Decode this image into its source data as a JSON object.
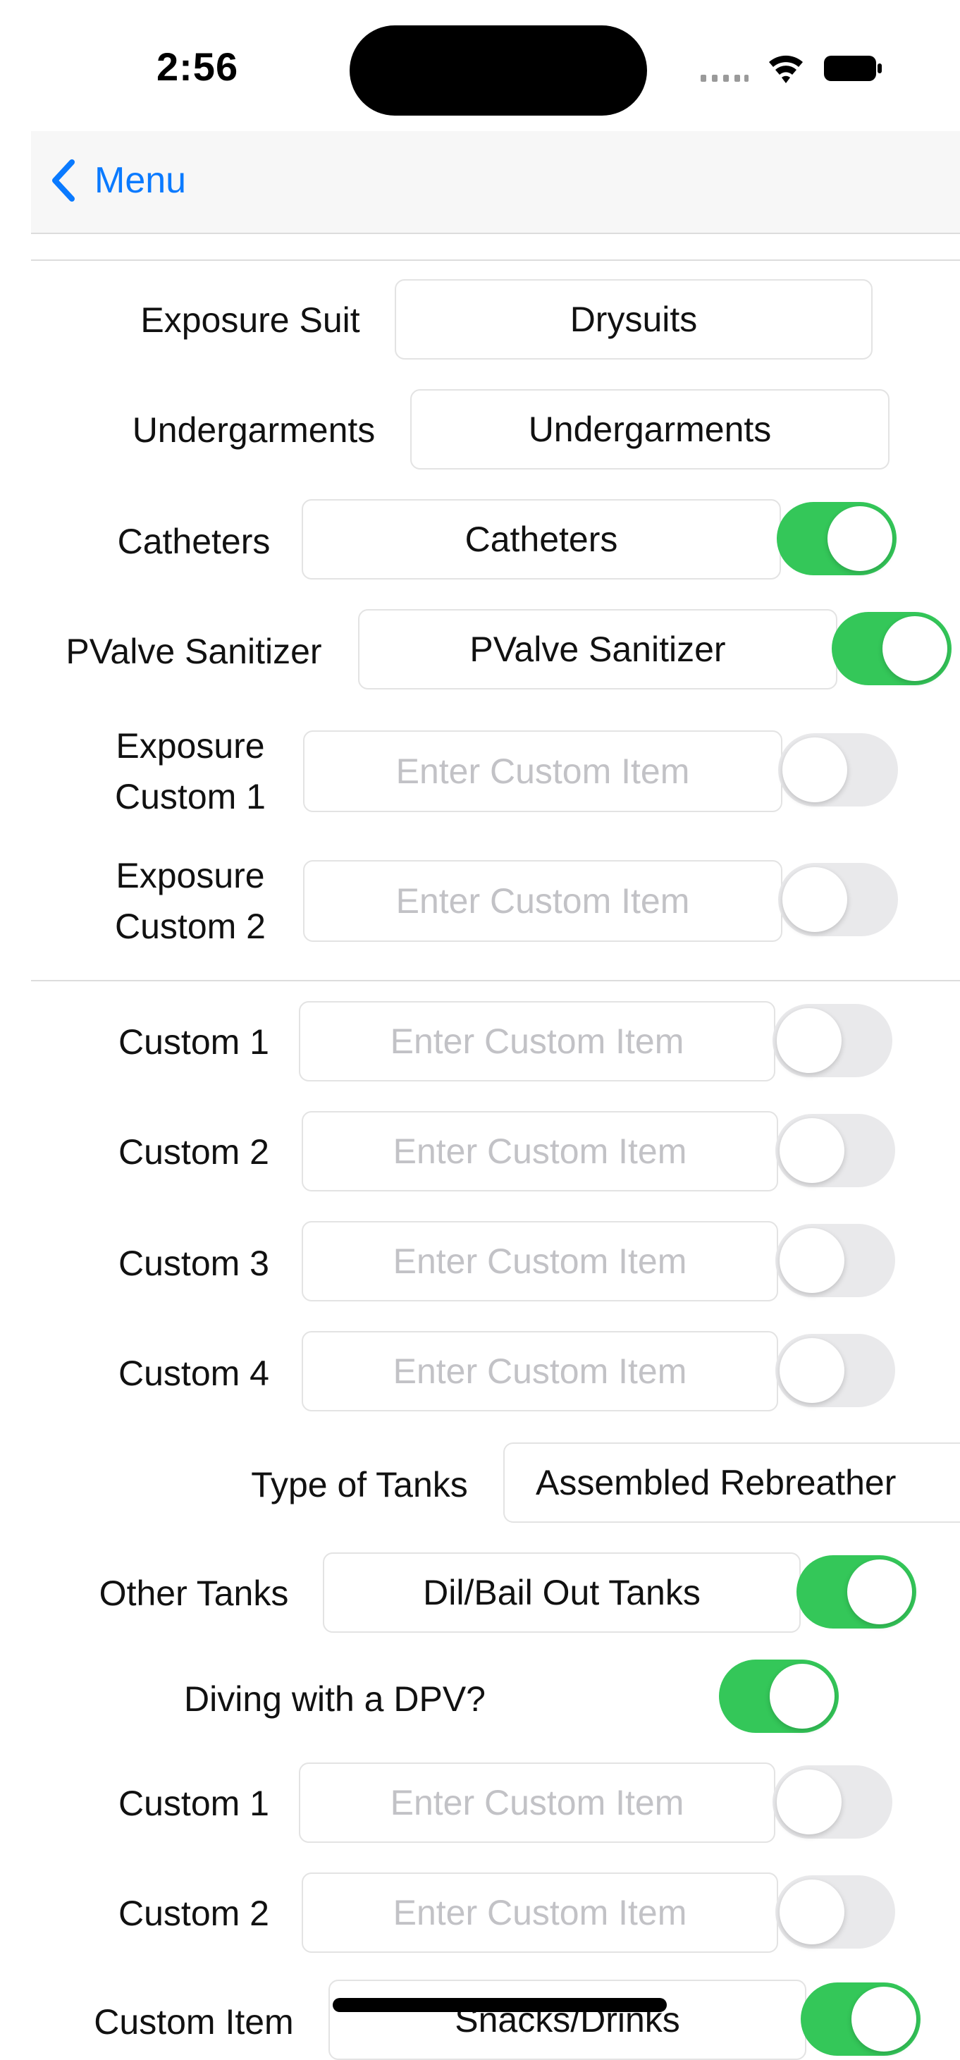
{
  "status_bar": {
    "time": "2:56"
  },
  "nav": {
    "back_label": "Menu"
  },
  "exposure_section": {
    "rows": [
      {
        "label": "Exposure Suit",
        "value": "Drysuits",
        "placeholder": ""
      },
      {
        "label": "Undergarments",
        "value": "Undergarments",
        "placeholder": ""
      },
      {
        "label": "Catheters",
        "value": "Catheters",
        "toggle": true
      },
      {
        "label": "PValve Sanitizer",
        "value": "PValve Sanitizer",
        "toggle": true
      },
      {
        "label": "Exposure Custom 1",
        "label_line1": "Exposure",
        "label_line2": "Custom 1",
        "value": "",
        "placeholder": "Enter Custom Item",
        "toggle": false
      },
      {
        "label": "Exposure Custom 2",
        "label_line1": "Exposure",
        "label_line2": "Custom 2",
        "value": "",
        "placeholder": "Enter Custom Item",
        "toggle": false
      }
    ]
  },
  "custom_section": {
    "rows": [
      {
        "label": "Custom 1",
        "value": "",
        "placeholder": "Enter Custom Item",
        "toggle": false
      },
      {
        "label": "Custom 2",
        "value": "",
        "placeholder": "Enter Custom Item",
        "toggle": false
      },
      {
        "label": "Custom 3",
        "value": "",
        "placeholder": "Enter Custom Item",
        "toggle": false
      },
      {
        "label": "Custom 4",
        "value": "",
        "placeholder": "Enter Custom Item",
        "toggle": false
      }
    ]
  },
  "tanks_section": {
    "type_label": "Type of Tanks",
    "type_value": "Assembled Rebreather",
    "other_label": "Other Tanks",
    "other_value": "Dil/Bail Out Tanks",
    "other_toggle": true,
    "dpv_label": "Diving with a DPV?",
    "dpv_toggle": true,
    "rows": [
      {
        "label": "Custom 1",
        "value": "",
        "placeholder": "Enter Custom Item",
        "toggle": false
      },
      {
        "label": "Custom 2",
        "value": "",
        "placeholder": "Enter Custom Item",
        "toggle": false
      }
    ],
    "partial_label": "Custom Item",
    "partial_value": "Snacks/Drinks",
    "partial_toggle": true
  },
  "colors": {
    "accent": "#0a7aff",
    "toggle_on": "#34c759",
    "toggle_off": "#e9e9eb",
    "placeholder": "#c2c2c6"
  }
}
